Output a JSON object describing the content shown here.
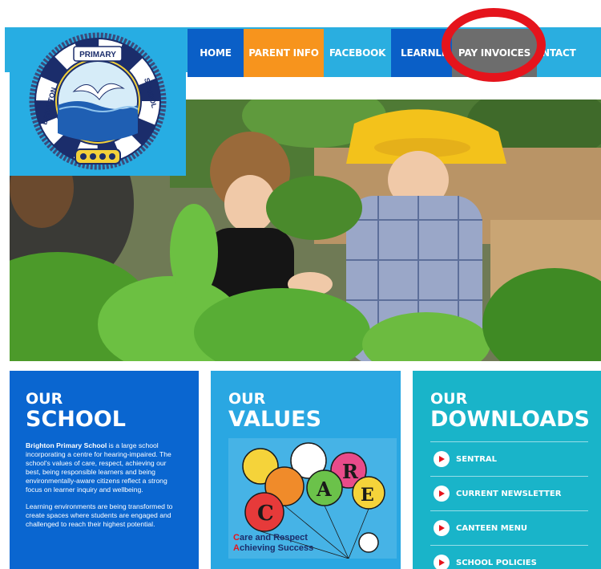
{
  "nav": {
    "items": [
      {
        "label": "HOME",
        "color": "#0a5fc7"
      },
      {
        "label": "PARENT INFO",
        "color": "#f7941d"
      },
      {
        "label": "FACEBOOK",
        "color": "#2aaee0"
      },
      {
        "label": "LEARNLI",
        "color": "#0a5fc7"
      },
      {
        "label": "PAY INVOICES",
        "color": "#6d6d6d"
      },
      {
        "label": "NTACT",
        "color": "#2aaee0"
      }
    ]
  },
  "logo": {
    "top_text": "PRIMARY",
    "left_text": "BRIGHTON",
    "right_text": "SCHOOL"
  },
  "school": {
    "title_small": "OUR",
    "title_big": "SCHOOL",
    "bold_lead": "Brighton Primary School",
    "para1": " is a large school incorporating a centre for hearing-impaired. The school's values of care, respect, achieving our best, being responsible learners and being environmentally-aware citizens reflect a strong focus on learner inquiry and wellbeing.",
    "para2": "Learning environments are being transformed to create spaces where students are engaged and challenged to reach their highest potential."
  },
  "values": {
    "title_small": "OUR",
    "title_big": "VALUES",
    "line1": "are and Respect",
    "line1_initial": "C",
    "line2": "chieving Success",
    "line2_initial": "A",
    "care_letters": [
      "C",
      "A",
      "R",
      "E"
    ]
  },
  "downloads": {
    "title_small": "OUR",
    "title_big": "DOWNLOADS",
    "items": [
      "SENTRAL",
      "CURRENT NEWSLETTER",
      "CANTEEN MENU",
      "SCHOOL POLICIES"
    ]
  },
  "colors": {
    "school_card": "#0a66d0",
    "values_card": "#2aa7e2",
    "downloads_card": "#19b4c9",
    "highlight_ring": "#e5141c"
  }
}
